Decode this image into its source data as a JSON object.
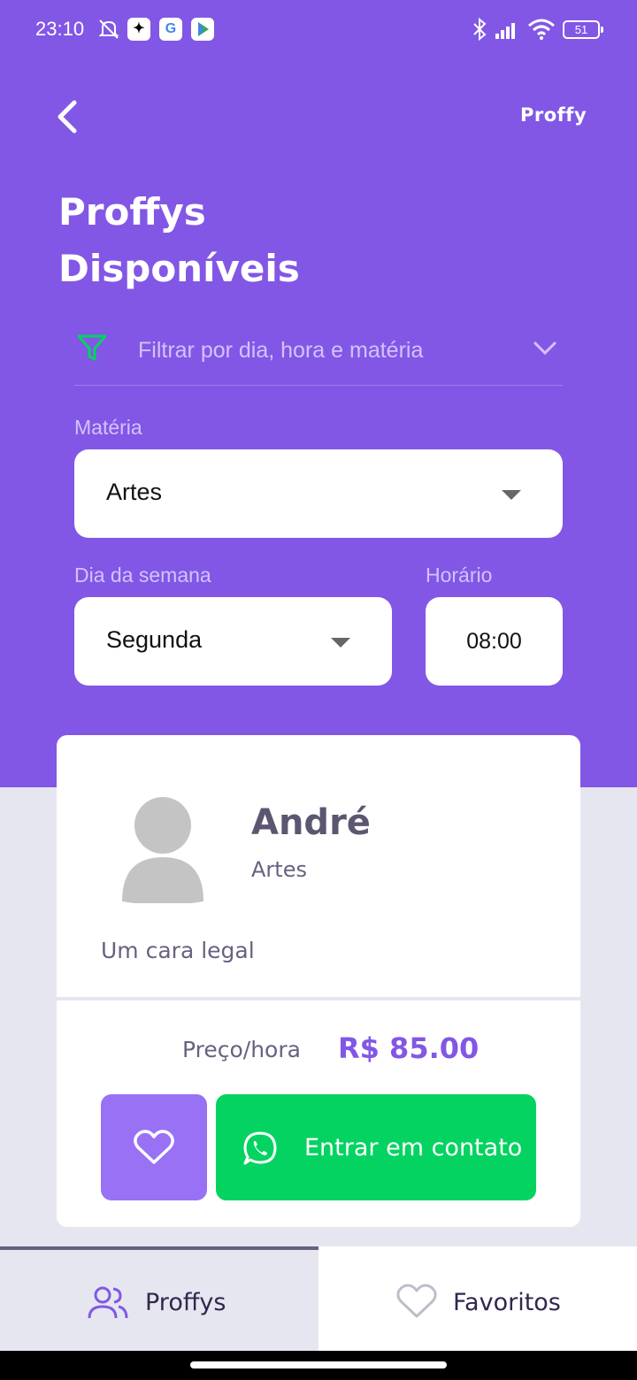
{
  "status_bar": {
    "time": "23:10",
    "battery": "51",
    "icons": [
      "mute-icon",
      "app-icon",
      "google-icon",
      "play-store-icon",
      "bluetooth-icon",
      "signal-icon",
      "wifi-icon",
      "battery-icon"
    ]
  },
  "header": {
    "back_icon": "chevron-left-icon",
    "logo": "Proffy"
  },
  "page": {
    "title_line1": "Proffys",
    "title_line2": "Disponíveis"
  },
  "filter": {
    "label": "Filtrar por dia, hora e matéria",
    "icon": "filter-icon",
    "toggle_icon": "chevron-down-icon",
    "subject_label": "Matéria",
    "subject_value": "Artes",
    "weekday_label": "Dia da semana",
    "weekday_value": "Segunda",
    "time_label": "Horário",
    "time_value": "08:00"
  },
  "teacher": {
    "name": "André",
    "subject": "Artes",
    "bio": "Um cara legal",
    "price_label": "Preço/hora",
    "price_value": "R$ 85.00",
    "favorite_icon": "heart-icon",
    "contact_label": "Entrar em contato",
    "contact_icon": "whatsapp-icon"
  },
  "tabs": [
    {
      "label": "Proffys",
      "icon": "users-icon",
      "active": true
    },
    {
      "label": "Favoritos",
      "icon": "heart-icon",
      "active": false
    }
  ],
  "colors": {
    "primary": "#8257e5",
    "primary_light": "#9871f5",
    "green": "#04d361",
    "background": "#e6e6f0",
    "text": "#6a6180"
  }
}
